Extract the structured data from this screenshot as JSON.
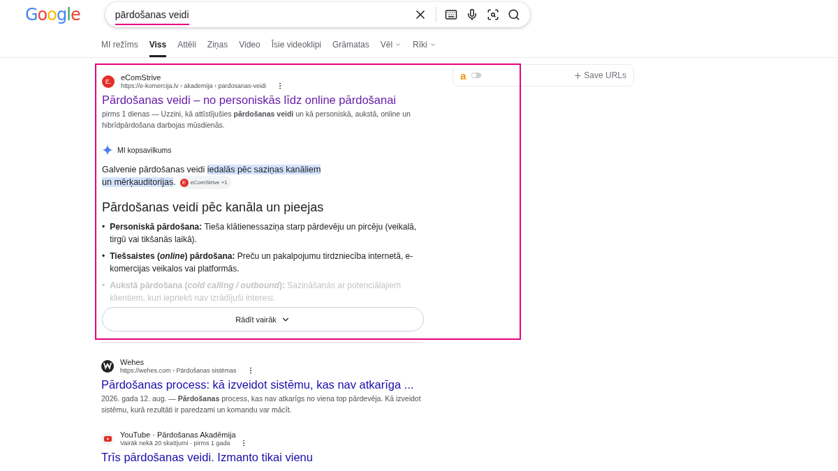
{
  "logo": "Google",
  "search": {
    "value": "pārdošanas veidi",
    "underlined": true
  },
  "tabs": [
    {
      "label": "MI režīms",
      "selected": false,
      "has_menu": false
    },
    {
      "label": "Viss",
      "selected": true,
      "has_menu": false
    },
    {
      "label": "Attēli",
      "selected": false,
      "has_menu": false
    },
    {
      "label": "Ziņas",
      "selected": false,
      "has_menu": false
    },
    {
      "label": "Video",
      "selected": false,
      "has_menu": false
    },
    {
      "label": "Īsie videoklipi",
      "selected": false,
      "has_menu": false
    },
    {
      "label": "Grāmatas",
      "selected": false,
      "has_menu": false
    },
    {
      "label": "Vēl",
      "selected": false,
      "has_menu": true
    },
    {
      "label": "Rīki",
      "selected": false,
      "has_menu": true
    }
  ],
  "featured": {
    "highlighted": true,
    "site": "eComStrive",
    "favicon": "E.",
    "url": "https://e-komercija.lv › akademija › pardosanas-veidi",
    "title": "Pārdošanas veidi – no personiskās līdz online pārdošanai",
    "visited": true,
    "snippet": "pirms 1 dienas — Uzzini, kā attīstījušies **pārdošanas veidi** un kā personiskā, aukstā, online un hibrīdpārdošana darbojas mūsdienās.",
    "ai_label": "MI kopsavilkums",
    "summary": [
      {
        "text": "Galvenie pārdošanas veidi ",
        "highlighted": false
      },
      {
        "text": "iedalās pēc saziņas kanāliem un mērķauditorijas",
        "highlighted": true
      },
      {
        "text": ".",
        "highlighted": false
      }
    ],
    "source_chip": {
      "icon": "E",
      "label": "eComStrive +1"
    },
    "heading": "Pārdošanas veidi pēc kanāla un pieejas",
    "bullets": [
      {
        "marker": "•",
        "term": "Personiskā pārdošana:",
        "text": "Tieša klātienessaziņa starp pārdevēju un pircēju (veikalā, tirgū vai tikšanās laikā).",
        "faded": false
      },
      {
        "marker": "•",
        "term": "Tiešsaistes (*online*) pārdošana:",
        "text": "Preču un pakalpojumu tirdzniecība internetā, e-komercijas veikalos vai platformās.",
        "faded": false
      },
      {
        "marker": "•",
        "term": "Aukstā pārdošana (*cold calling / outbound*):",
        "text": "Sazināšanās ar potenciālajiem klientiem, kuri iepriekš nav izrādījuši interesi.",
        "faded": true
      }
    ],
    "more_button": "Rādīt vairāk"
  },
  "side_panel": {
    "logo_letter": "a",
    "toggle_on": false,
    "button": "Save URLs"
  },
  "results": [
    {
      "kind": "web",
      "site": "Wehes",
      "url": "https://wehes.com › Pārdošanas sistēmas",
      "title": "Pārdošanas process: kā izveidot sistēmu, kas nav atkarīga ...",
      "visited": false,
      "snippet": "2026. gada 12. aug. — **Pārdošanas** process, kas nav atkarīgs no viena top pārdevēja. Kā izveidot sistēmu, kurā rezultāti ir paredzami un komandu var mācīt."
    },
    {
      "kind": "video",
      "site": "YouTube · Pārdošanas Akadēmija",
      "url": "Vairāk nekā 20 skatījumi · pirms 1 gada",
      "title": "Trīs pārdošanas veidi. Izmanto tikai vienu",
      "visited": false
    }
  ]
}
